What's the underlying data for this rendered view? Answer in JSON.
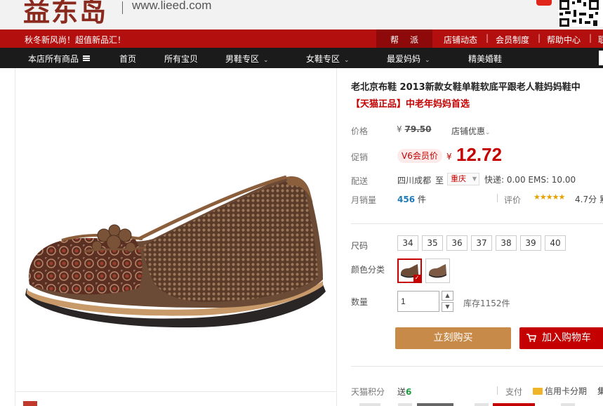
{
  "header": {
    "logo_text": "益东岛",
    "site_url": "www.lieed.com"
  },
  "promo_bar": {
    "promo_text": "秋冬新风尚！超值新品汇！",
    "links": [
      "帮",
      "派",
      "店铺动态",
      "会员制度",
      "帮助中心",
      "联"
    ]
  },
  "nav": {
    "items": [
      "本店所有商品",
      "首页",
      "所有宝贝",
      "男鞋专区",
      "女鞋专区",
      "最爱妈妈",
      "精美婚鞋"
    ]
  },
  "product": {
    "title": "老北京布鞋 2013新款女鞋单鞋软底平跟老人鞋妈妈鞋中",
    "subtitle": "【天猫正品】中老年妈妈首选",
    "price_label": "价格",
    "old_price_symbol": "¥",
    "old_price": "79.50",
    "shop_discount": "店铺优惠",
    "promo_label": "促销",
    "promo_tag": "V6会员价",
    "currency": "¥",
    "price": "12.72",
    "shipping_label": "配送",
    "ship_from": "四川成都",
    "ship_to_word": "至",
    "ship_dest": "重庆",
    "ship_cost": "快递: 0.00 EMS: 10.00",
    "sold_label": "月销量",
    "sold_count": "456",
    "sold_unit": "件",
    "review_label": "评价",
    "stars": "★★★★★",
    "rating": "4.7分",
    "rating_extra": "累",
    "size_label": "尺码",
    "sizes": [
      "34",
      "35",
      "36",
      "37",
      "38",
      "39",
      "40"
    ],
    "color_label": "颜色分类",
    "qty_label": "数量",
    "qty_value": "1",
    "stock": "库存1152件",
    "buy_now": "立刻购买",
    "add_to_cart": "加入购物车",
    "tmall_points_label": "天猫积分",
    "tmall_points": "送",
    "tmall_points_num": "6",
    "pay_label": "支付",
    "pay_method": "信用卡分期",
    "pay_extra": "集"
  },
  "colors": {
    "brand_red": "#b40f0f",
    "price_red": "#c40000",
    "nav_dark": "#1b1b1b",
    "buy_button": "#c88a48"
  }
}
